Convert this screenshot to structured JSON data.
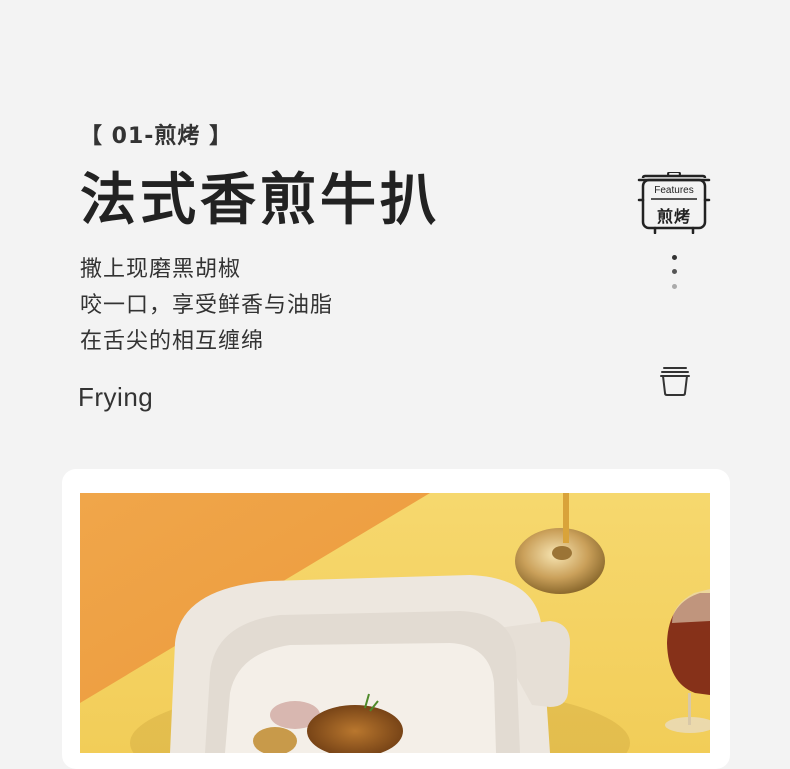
{
  "section": {
    "tag": "【 01-煎烤 】",
    "title": "法式香煎牛扒",
    "description_lines": [
      "撒上现磨黑胡椒",
      "咬一口，享受鲜香与油脂",
      "在舌尖的相互缠绵"
    ],
    "english": "Frying"
  },
  "badge": {
    "top_text": "Features",
    "bottom_text": "煎烤",
    "icon": "cooking-pot-badge-icon"
  },
  "side_icons": {
    "dots": "vertical-dots-icon",
    "pot": "pot-outline-icon"
  },
  "colors": {
    "background": "#f3f3f3",
    "text": "#2b2b2b",
    "orange_wall": "#f0a445",
    "yellow_table": "#f5d364",
    "pot_white": "#ece6de"
  }
}
